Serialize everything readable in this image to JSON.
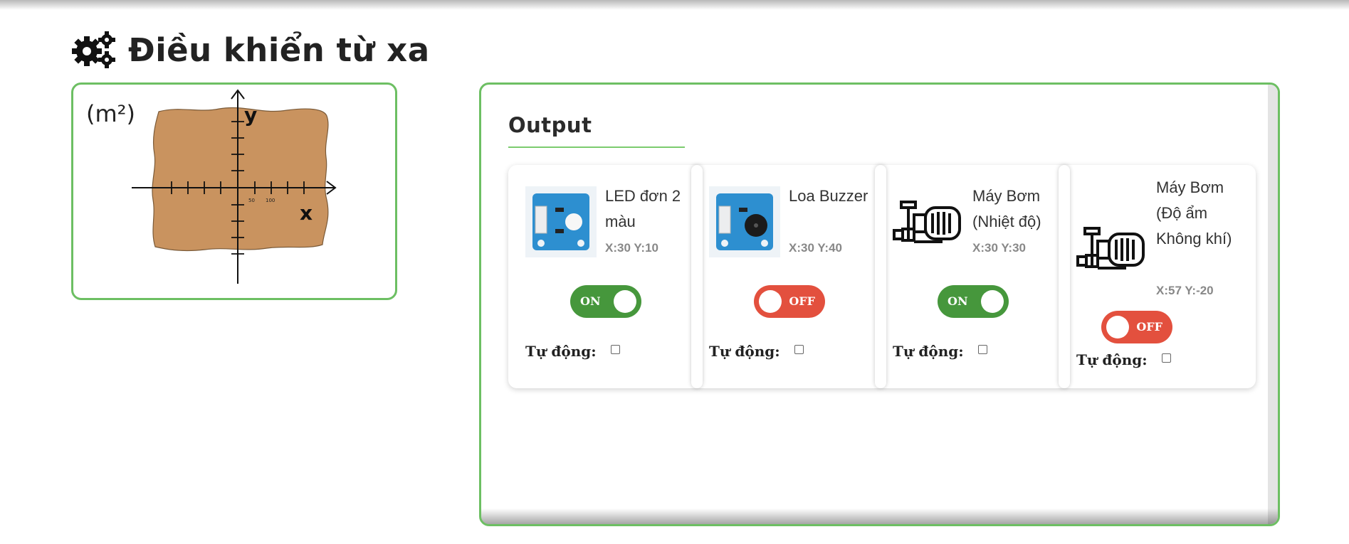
{
  "page": {
    "title": "Điều khiển từ xa",
    "title_icon": "gears-icon"
  },
  "map": {
    "unit_label": "(m²)",
    "axis_x": "x",
    "axis_y": "y",
    "tick_50": "50",
    "tick_100": "100",
    "field_color": "#c9935f"
  },
  "output": {
    "heading": "Output",
    "accent_color": "#6dbf63",
    "devices": [
      {
        "name": "LED đơn 2 màu",
        "coords": "X:30 Y:10",
        "state": "ON",
        "icon": "led-module-icon",
        "auto_label": "Tự động:",
        "auto_checked": false
      },
      {
        "name": "Loa Buzzer",
        "coords": "X:30 Y:40",
        "state": "OFF",
        "icon": "buzzer-module-icon",
        "auto_label": "Tự động:",
        "auto_checked": false
      },
      {
        "name": "Máy Bơm (Nhiệt độ)",
        "coords": "X:30 Y:30",
        "state": "ON",
        "icon": "pump-icon",
        "auto_label": "Tự động:",
        "auto_checked": false
      },
      {
        "name": "Máy Bơm (Độ ẩm Không khí)",
        "coords": "X:57 Y:-20",
        "state": "OFF",
        "icon": "pump-icon",
        "auto_label": "Tự động:",
        "auto_checked": false
      }
    ]
  },
  "colors": {
    "on": "#46973c",
    "off": "#e3503e"
  }
}
